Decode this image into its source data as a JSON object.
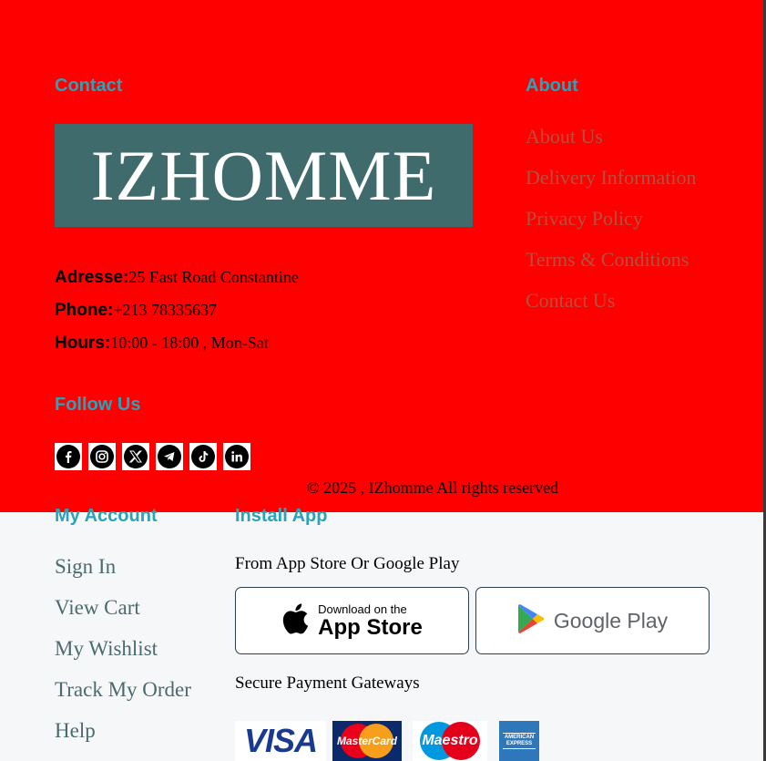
{
  "contact": {
    "heading": "Contact",
    "logo_text": "IZHOMME",
    "address_label": "Adresse:",
    "address_value": "25 East Road Constantine",
    "phone_label": "Phone:",
    "phone_value": "+213 78335637",
    "hours_label": "Hours:",
    "hours_value": "10:00 - 18:00 , Mon-Sat",
    "follow_heading": "Follow Us",
    "social_icons": [
      "facebook-icon",
      "instagram-icon",
      "x-icon",
      "telegram-icon",
      "tiktok-icon",
      "linkedin-icon"
    ]
  },
  "about": {
    "heading": "About",
    "links": [
      "About Us",
      "Delivery Information",
      "Privacy Policy",
      "Terms & Conditions",
      "Contact Us"
    ]
  },
  "copyright": "© 2025 , IZhomme All rights reserved",
  "account": {
    "heading": "My Account",
    "links": [
      "Sign In",
      "View Cart",
      "My Wishlist",
      "Track My Order",
      "Help"
    ]
  },
  "install": {
    "heading": "Install App",
    "subtitle": "From App Store Or Google Play",
    "app_store_small": "Download on the",
    "app_store_big": "App Store",
    "google_play": "Google Play",
    "payment_heading": "Secure Payment Gateways",
    "payment_logos": [
      "VISA",
      "MasterCard",
      "Maestro",
      "AMERICAN EXPRESS"
    ]
  },
  "colors": {
    "band": "#ff0000",
    "heading": "#2aa3b8",
    "logo_bg": "#3f6b6d",
    "about_link": "#b4503f",
    "account_link": "#4a6a6e"
  }
}
